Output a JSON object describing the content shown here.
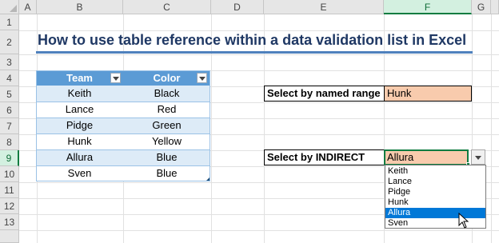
{
  "columns": [
    "A",
    "B",
    "C",
    "D",
    "E",
    "F",
    "G"
  ],
  "rows": [
    "1",
    "2",
    "3",
    "4",
    "5",
    "6",
    "7",
    "8",
    "9",
    "10",
    "11",
    "12",
    "13"
  ],
  "selected": {
    "column": "F",
    "row": "9"
  },
  "title": "How to use table reference within a data validation list in Excel",
  "table": {
    "headers": [
      "Team",
      "Color"
    ],
    "rows": [
      [
        "Keith",
        "Black"
      ],
      [
        "Lance",
        "Red"
      ],
      [
        "Pidge",
        "Green"
      ],
      [
        "Hunk",
        "Yellow"
      ],
      [
        "Allura",
        "Blue"
      ],
      [
        "Sven",
        "Blue"
      ]
    ]
  },
  "named_range": {
    "label": "Select by named range",
    "value": "Hunk"
  },
  "indirect": {
    "label": "Select by INDIRECT",
    "value": "Allura"
  },
  "dropdown": {
    "options": [
      "Keith",
      "Lance",
      "Pidge",
      "Hunk",
      "Allura",
      "Sven"
    ],
    "highlighted_index": 4
  },
  "colors": {
    "title": "#1f3864",
    "table_header": "#5b9bd5",
    "table_band": "#ddebf7",
    "value_fill": "#f8cbad",
    "excel_green": "#107c41",
    "highlight": "#0078d7"
  }
}
